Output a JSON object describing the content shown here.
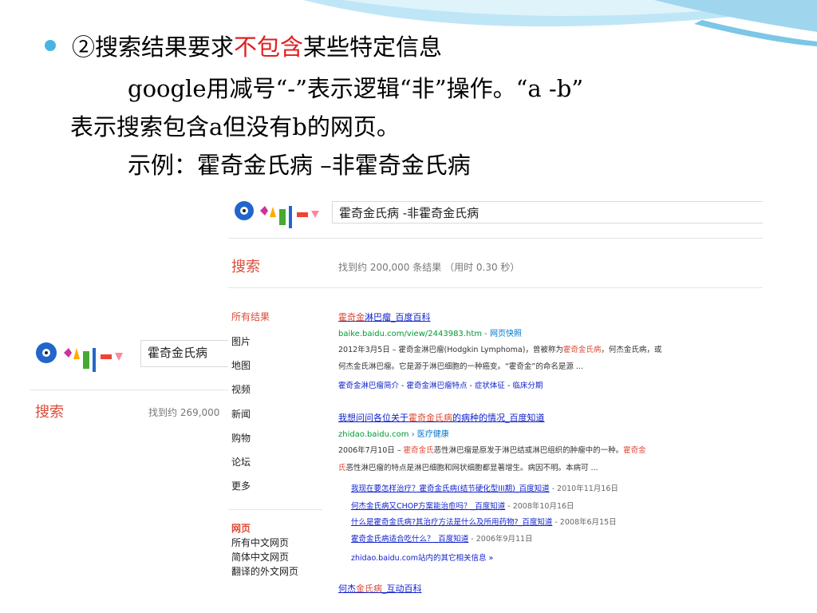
{
  "slide": {
    "line1_a": "②搜索结果要求",
    "line1_red": "不包含",
    "line1_b": "某些特定信息",
    "line2": "google用减号“-”表示逻辑“非”操作。“a -b”",
    "line3": "表示搜索包含a但没有b的网页。",
    "line4": "示例：霍奇金氏病 –非霍奇金氏病"
  },
  "shot_small": {
    "query": "霍奇金氏病",
    "search_label": "搜索",
    "stats": "找到约 269,000 "
  },
  "shot_main": {
    "query": "霍奇金氏病 -非霍奇金氏病",
    "search_label": "搜索",
    "stats": "找到约 200,000 条结果 （用时 0.30 秒）",
    "nav": [
      "所有结果",
      "图片",
      "地图",
      "视频",
      "新闻",
      "购物",
      "论坛",
      "更多"
    ],
    "nav_section": "网页",
    "nav_sub": [
      "所有中文网页",
      "简体中文网页",
      "翻译的外文网页"
    ],
    "r1": {
      "title_hl": "霍奇金",
      "title_rest": "淋巴瘤_百度百科",
      "url": "baike.baidu.com/view/2443983.htm",
      "url_extra": " - 网页快照",
      "snip1_a": "2012年3月5日 – 霍奇金淋巴瘤(Hodgkin Lymphoma)，曾被称为",
      "snip1_hl": "霍奇金氏病",
      "snip1_b": "，何杰金氏病，或",
      "snip2": "何杰金氏淋巴瘤。它是源于淋巴细胞的一种癌变。“霍奇金”的命名是源 ...",
      "links": "霍奇金淋巴瘤简介 - 霍奇金淋巴瘤特点 - 症状体征 - 临床分期"
    },
    "r2": {
      "title_a": "我想问问各位关于",
      "title_hl": "霍奇金氏病",
      "title_b": "的病种的情况_百度知道",
      "url": "zhidao.baidu.com",
      "url_extra": " › 医疗健康",
      "snip1_a": "2006年7月10日 – ",
      "snip1_hl": "霍奇金氏",
      "snip1_b": "恶性淋巴瘤是原发于淋巴结或淋巴组织的肿瘤中的一种。",
      "snip1_hl2": "霍奇金",
      "snip2_hl": "氏",
      "snip2": "恶性淋巴瘤的特点是淋巴细胞和网状细胞都显著增生。病因不明。本病可 ...",
      "sub": [
        {
          "title": "我现在要怎样治疗？霍奇金氏病(结节硬化型III期)_百度知道",
          "date": " - 2010年11月16日"
        },
        {
          "title": "何杰金氏病又CHOP方案能治愈吗？_百度知道",
          "date": " - 2008年10月16日"
        },
        {
          "title": "什么是霍奇金氏病?其治疗方法是什么及所用药物?_百度知道",
          "date": " - 2008年6月15日"
        },
        {
          "title": "霍奇金氏病适合吃什么？_百度知道",
          "date": " - 2006年9月11日"
        }
      ],
      "more": "zhidao.baidu.com站内的其它相关信息 »"
    },
    "r3": {
      "title_a": "何杰",
      "title_hl": "金氏病",
      "title_b": "_互动百科"
    }
  },
  "colors": {
    "accent": "#dd4b39",
    "link": "#1122cc",
    "url": "#009933",
    "bullet": "#48b5e0"
  }
}
